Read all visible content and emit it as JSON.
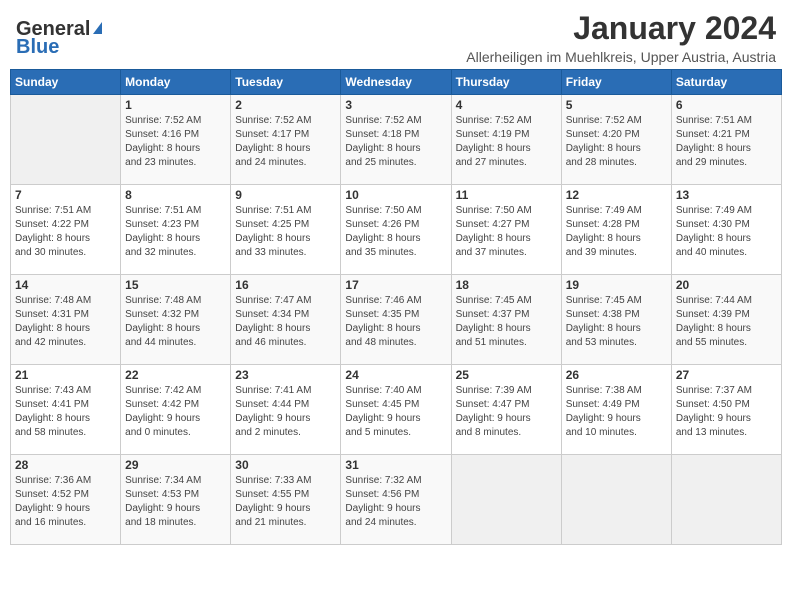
{
  "logo": {
    "general": "General",
    "blue": "Blue"
  },
  "title": "January 2024",
  "location": "Allerheiligen im Muehlkreis, Upper Austria, Austria",
  "days_of_week": [
    "Sunday",
    "Monday",
    "Tuesday",
    "Wednesday",
    "Thursday",
    "Friday",
    "Saturday"
  ],
  "weeks": [
    [
      {
        "day": "",
        "info": ""
      },
      {
        "day": "1",
        "info": "Sunrise: 7:52 AM\nSunset: 4:16 PM\nDaylight: 8 hours\nand 23 minutes."
      },
      {
        "day": "2",
        "info": "Sunrise: 7:52 AM\nSunset: 4:17 PM\nDaylight: 8 hours\nand 24 minutes."
      },
      {
        "day": "3",
        "info": "Sunrise: 7:52 AM\nSunset: 4:18 PM\nDaylight: 8 hours\nand 25 minutes."
      },
      {
        "day": "4",
        "info": "Sunrise: 7:52 AM\nSunset: 4:19 PM\nDaylight: 8 hours\nand 27 minutes."
      },
      {
        "day": "5",
        "info": "Sunrise: 7:52 AM\nSunset: 4:20 PM\nDaylight: 8 hours\nand 28 minutes."
      },
      {
        "day": "6",
        "info": "Sunrise: 7:51 AM\nSunset: 4:21 PM\nDaylight: 8 hours\nand 29 minutes."
      }
    ],
    [
      {
        "day": "7",
        "info": "Sunrise: 7:51 AM\nSunset: 4:22 PM\nDaylight: 8 hours\nand 30 minutes."
      },
      {
        "day": "8",
        "info": "Sunrise: 7:51 AM\nSunset: 4:23 PM\nDaylight: 8 hours\nand 32 minutes."
      },
      {
        "day": "9",
        "info": "Sunrise: 7:51 AM\nSunset: 4:25 PM\nDaylight: 8 hours\nand 33 minutes."
      },
      {
        "day": "10",
        "info": "Sunrise: 7:50 AM\nSunset: 4:26 PM\nDaylight: 8 hours\nand 35 minutes."
      },
      {
        "day": "11",
        "info": "Sunrise: 7:50 AM\nSunset: 4:27 PM\nDaylight: 8 hours\nand 37 minutes."
      },
      {
        "day": "12",
        "info": "Sunrise: 7:49 AM\nSunset: 4:28 PM\nDaylight: 8 hours\nand 39 minutes."
      },
      {
        "day": "13",
        "info": "Sunrise: 7:49 AM\nSunset: 4:30 PM\nDaylight: 8 hours\nand 40 minutes."
      }
    ],
    [
      {
        "day": "14",
        "info": "Sunrise: 7:48 AM\nSunset: 4:31 PM\nDaylight: 8 hours\nand 42 minutes."
      },
      {
        "day": "15",
        "info": "Sunrise: 7:48 AM\nSunset: 4:32 PM\nDaylight: 8 hours\nand 44 minutes."
      },
      {
        "day": "16",
        "info": "Sunrise: 7:47 AM\nSunset: 4:34 PM\nDaylight: 8 hours\nand 46 minutes."
      },
      {
        "day": "17",
        "info": "Sunrise: 7:46 AM\nSunset: 4:35 PM\nDaylight: 8 hours\nand 48 minutes."
      },
      {
        "day": "18",
        "info": "Sunrise: 7:45 AM\nSunset: 4:37 PM\nDaylight: 8 hours\nand 51 minutes."
      },
      {
        "day": "19",
        "info": "Sunrise: 7:45 AM\nSunset: 4:38 PM\nDaylight: 8 hours\nand 53 minutes."
      },
      {
        "day": "20",
        "info": "Sunrise: 7:44 AM\nSunset: 4:39 PM\nDaylight: 8 hours\nand 55 minutes."
      }
    ],
    [
      {
        "day": "21",
        "info": "Sunrise: 7:43 AM\nSunset: 4:41 PM\nDaylight: 8 hours\nand 58 minutes."
      },
      {
        "day": "22",
        "info": "Sunrise: 7:42 AM\nSunset: 4:42 PM\nDaylight: 9 hours\nand 0 minutes."
      },
      {
        "day": "23",
        "info": "Sunrise: 7:41 AM\nSunset: 4:44 PM\nDaylight: 9 hours\nand 2 minutes."
      },
      {
        "day": "24",
        "info": "Sunrise: 7:40 AM\nSunset: 4:45 PM\nDaylight: 9 hours\nand 5 minutes."
      },
      {
        "day": "25",
        "info": "Sunrise: 7:39 AM\nSunset: 4:47 PM\nDaylight: 9 hours\nand 8 minutes."
      },
      {
        "day": "26",
        "info": "Sunrise: 7:38 AM\nSunset: 4:49 PM\nDaylight: 9 hours\nand 10 minutes."
      },
      {
        "day": "27",
        "info": "Sunrise: 7:37 AM\nSunset: 4:50 PM\nDaylight: 9 hours\nand 13 minutes."
      }
    ],
    [
      {
        "day": "28",
        "info": "Sunrise: 7:36 AM\nSunset: 4:52 PM\nDaylight: 9 hours\nand 16 minutes."
      },
      {
        "day": "29",
        "info": "Sunrise: 7:34 AM\nSunset: 4:53 PM\nDaylight: 9 hours\nand 18 minutes."
      },
      {
        "day": "30",
        "info": "Sunrise: 7:33 AM\nSunset: 4:55 PM\nDaylight: 9 hours\nand 21 minutes."
      },
      {
        "day": "31",
        "info": "Sunrise: 7:32 AM\nSunset: 4:56 PM\nDaylight: 9 hours\nand 24 minutes."
      },
      {
        "day": "",
        "info": ""
      },
      {
        "day": "",
        "info": ""
      },
      {
        "day": "",
        "info": ""
      }
    ]
  ]
}
